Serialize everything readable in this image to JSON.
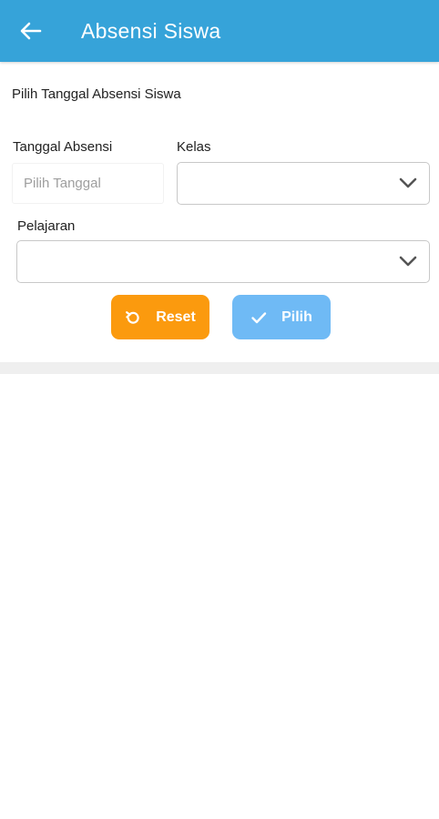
{
  "app_bar": {
    "title": "Absensi Siswa",
    "back_icon": "arrow-left-icon",
    "background": "#36a3d9"
  },
  "form": {
    "section_title": "Pilih Tanggal Absensi Siswa",
    "date": {
      "label": "Tanggal Absensi",
      "placeholder": "Pilih Tanggal",
      "value": ""
    },
    "kelas": {
      "label": "Kelas",
      "value": "",
      "icon": "chevron-down-icon"
    },
    "pelajaran": {
      "label": "Pelajaran",
      "value": "",
      "icon": "chevron-down-icon"
    }
  },
  "buttons": {
    "reset": {
      "label": "Reset",
      "icon": "refresh-icon",
      "color": "#fb9a0e"
    },
    "pilih": {
      "label": "Pilih",
      "icon": "check-icon",
      "color": "#6fbaf5"
    }
  }
}
